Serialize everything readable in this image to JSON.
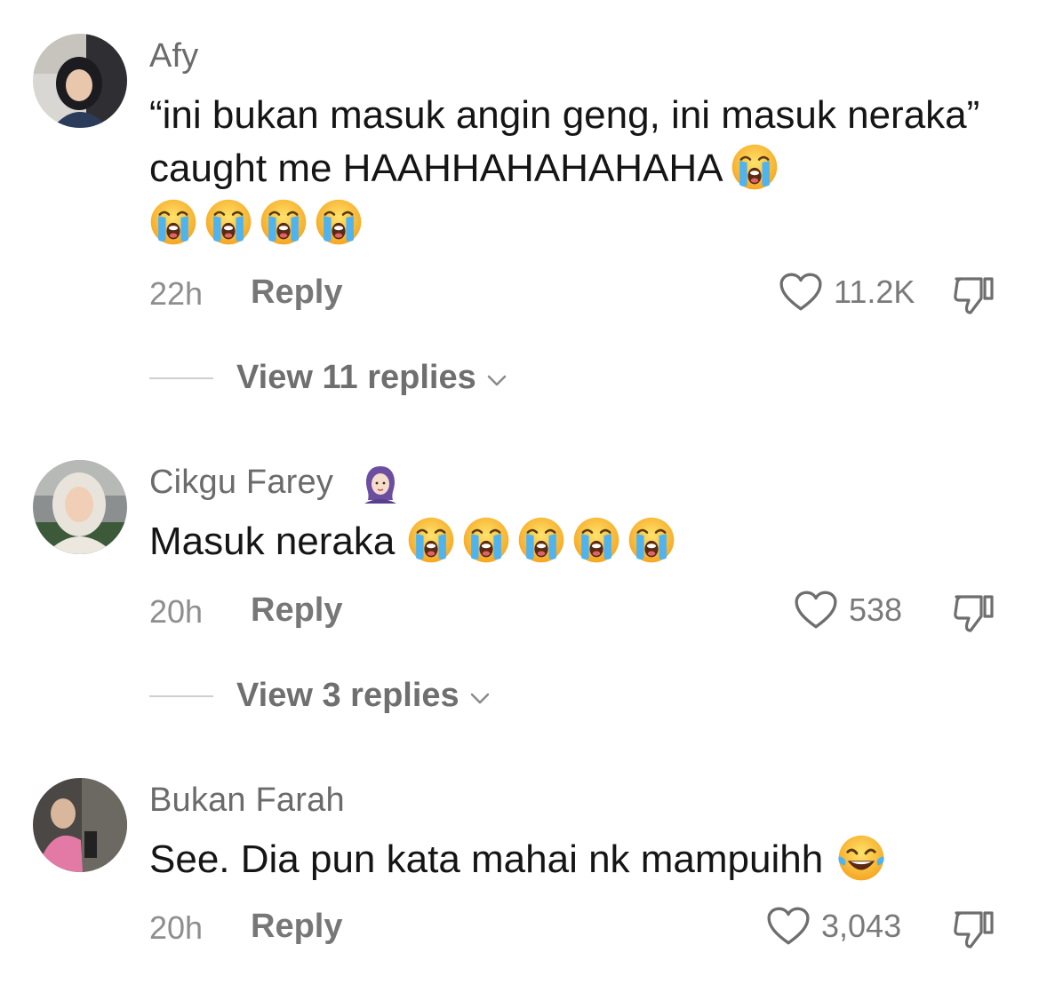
{
  "comments": [
    {
      "username": "Afy",
      "text": "“ini bukan masuk angin geng, ini masuk neraka” caught me HAAHHAHAHAHAHA",
      "time": "22h",
      "reply_label": "Reply",
      "likes": "11.2K",
      "view_replies": "View 11 replies",
      "emoji_icon": "loudly-crying-face"
    },
    {
      "username": "Cikgu Farey",
      "badge_icon": "woman-with-headscarf",
      "text": "Masuk neraka",
      "time": "20h",
      "reply_label": "Reply",
      "likes": "538",
      "view_replies": "View 3 replies",
      "emoji_icon": "loudly-crying-face"
    },
    {
      "username": "Bukan Farah",
      "text": "See. Dia pun kata mahai nk mampuihh",
      "time": "20h",
      "reply_label": "Reply",
      "likes": "3,043",
      "emoji_icon": "face-with-tears-of-joy"
    }
  ],
  "colors": {
    "username": "#6b6b6b",
    "text": "#151515",
    "meta": "#8e8e8e",
    "background": "#ffffff"
  }
}
